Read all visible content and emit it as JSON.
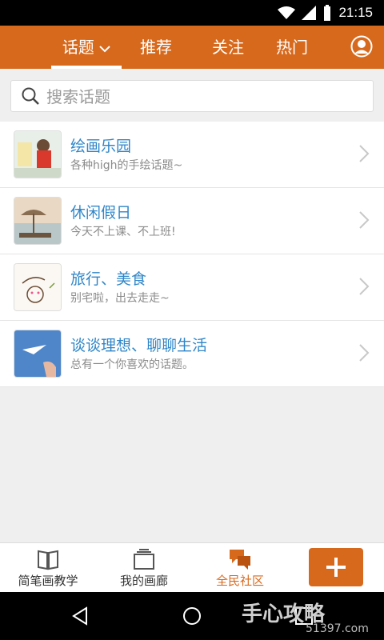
{
  "status_bar": {
    "time": "21:15"
  },
  "header": {
    "tabs": [
      {
        "label": "话题",
        "active": true
      },
      {
        "label": "推荐"
      },
      {
        "label": "关注"
      },
      {
        "label": "热门"
      }
    ],
    "colors": {
      "brand": "#d7691d"
    }
  },
  "search": {
    "placeholder": "搜索话题"
  },
  "topics": [
    {
      "title": "绘画乐园",
      "desc": "各种high的手绘话题~",
      "icon": "painting-girl-thumb"
    },
    {
      "title": "休闲假日",
      "desc": "今天不上课、不上班!",
      "icon": "beach-umbrella-thumb"
    },
    {
      "title": "旅行、美食",
      "desc": "别宅啦，出去走走~",
      "icon": "food-doodle-thumb"
    },
    {
      "title": "谈谈理想、聊聊生活",
      "desc": "总有一个你喜欢的话题。",
      "icon": "paper-plane-thumb"
    }
  ],
  "bottom_nav": [
    {
      "label": "简笔画教学",
      "icon": "book-icon"
    },
    {
      "label": "我的画廊",
      "icon": "gallery-icon"
    },
    {
      "label": "全民社区",
      "icon": "chat-bubbles-icon",
      "active": true
    }
  ],
  "add_button": {
    "icon": "plus-icon"
  },
  "watermark": {
    "text": "手心攻略",
    "sub": "51397.com"
  }
}
